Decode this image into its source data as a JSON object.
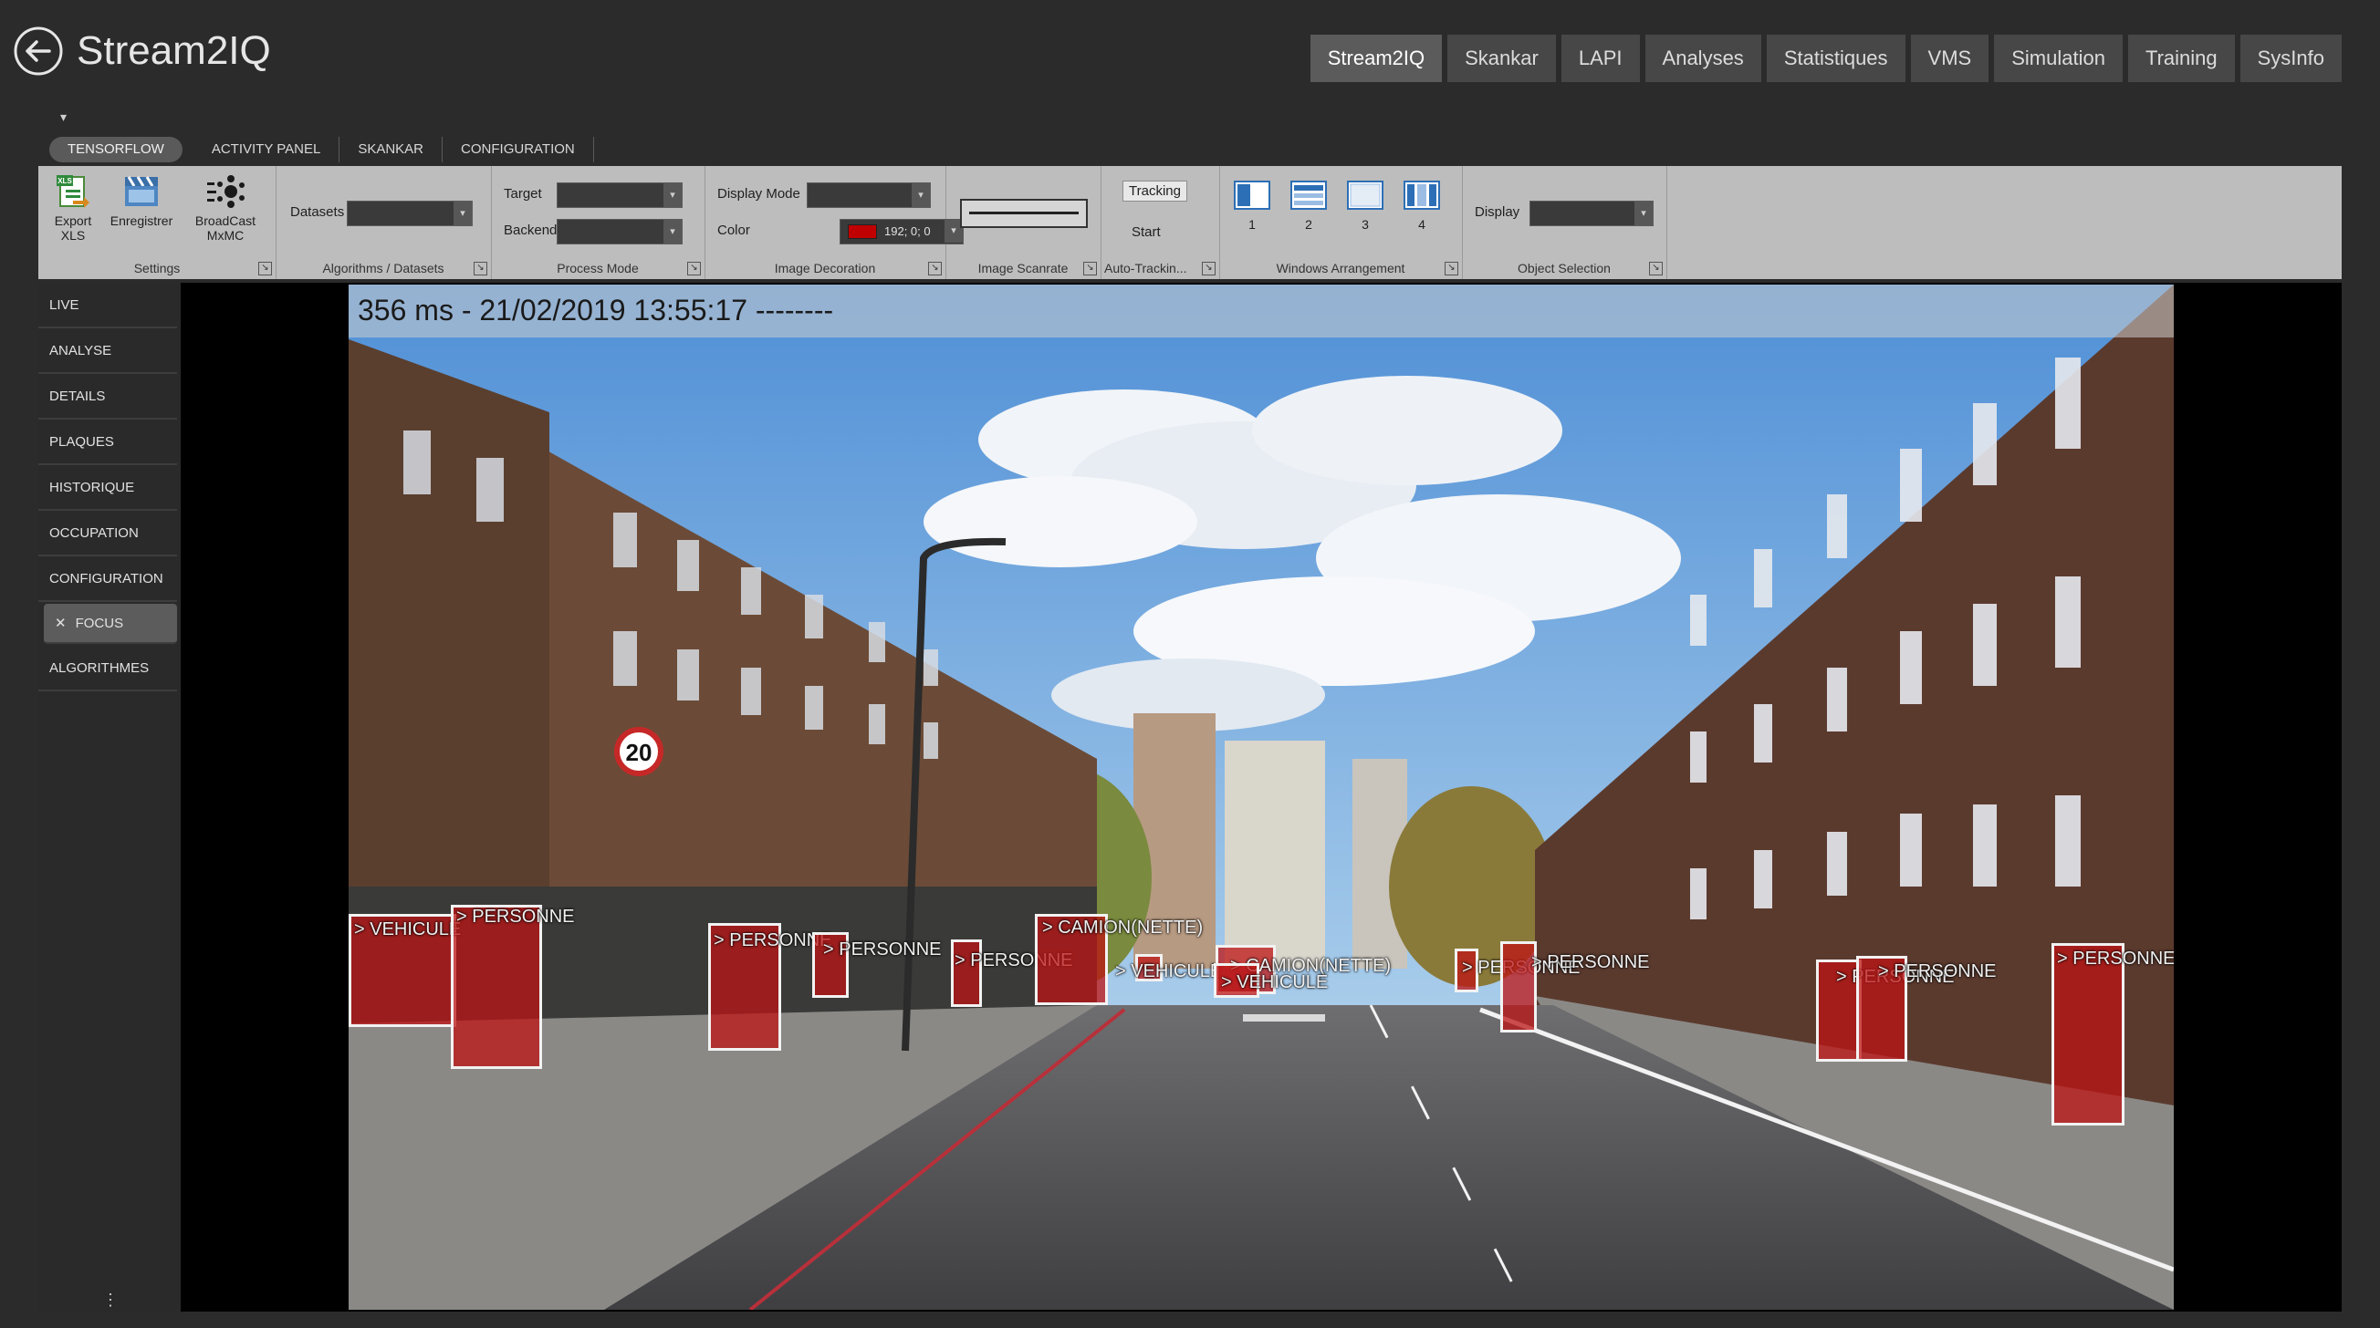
{
  "header": {
    "title": "Stream2IQ",
    "back_icon": "arrow-left-circle-icon",
    "nav": [
      {
        "label": "Stream2IQ",
        "active": true
      },
      {
        "label": "Skankar",
        "active": false
      },
      {
        "label": "LAPI",
        "active": false
      },
      {
        "label": "Analyses",
        "active": false
      },
      {
        "label": "Statistiques",
        "active": false
      },
      {
        "label": "VMS",
        "active": false
      },
      {
        "label": "Simulation",
        "active": false
      },
      {
        "label": "Training",
        "active": false
      },
      {
        "label": "SysInfo",
        "active": false
      }
    ]
  },
  "ribbon_tabs": [
    {
      "label": "TENSORFLOW",
      "active": true
    },
    {
      "label": "ACTIVITY PANEL",
      "active": false
    },
    {
      "label": "SKANKAR",
      "active": false
    },
    {
      "label": "CONFIGURATION",
      "active": false
    }
  ],
  "ribbon": {
    "settings": {
      "label": "Settings",
      "export_label_1": "Export",
      "export_label_2": "XLS",
      "record_label": "Enregistrer",
      "broadcast_label_1": "BroadCast",
      "broadcast_label_2": "MxMC"
    },
    "algorithms": {
      "label": "Algorithms / Datasets",
      "datasets_label": "Datasets",
      "datasets_value": ""
    },
    "process_mode": {
      "label": "Process Mode",
      "target_label": "Target",
      "target_value": "",
      "backend_label": "Backend",
      "backend_value": ""
    },
    "image_decoration": {
      "label": "Image Decoration",
      "display_mode_label": "Display Mode",
      "display_mode_value": "",
      "color_label": "Color",
      "color_value": "192; 0; 0",
      "color_hex": "#c00000"
    },
    "image_scanrate": {
      "label": "Image Scanrate"
    },
    "auto_tracking": {
      "label": "Auto-Trackin...",
      "tracking_label": "Tracking",
      "start_label": "Start"
    },
    "windows_arrangement": {
      "label": "Windows Arrangement",
      "options": [
        "1",
        "2",
        "3",
        "4"
      ]
    },
    "object_selection": {
      "label": "Object Selection",
      "display_label": "Display",
      "display_value": ""
    }
  },
  "sidebar": {
    "items": [
      {
        "label": "LIVE",
        "active": false
      },
      {
        "label": "ANALYSE",
        "active": false
      },
      {
        "label": "DETAILS",
        "active": false
      },
      {
        "label": "PLAQUES",
        "active": false
      },
      {
        "label": "HISTORIQUE",
        "active": false
      },
      {
        "label": "OCCUPATION",
        "active": false
      },
      {
        "label": "CONFIGURATION",
        "active": false
      },
      {
        "label": "FOCUS",
        "active": true
      },
      {
        "label": "ALGORITHMES",
        "active": false
      }
    ],
    "more": "..."
  },
  "video": {
    "overlay_text": "356 ms - 21/02/2019 13:55:17   --------",
    "detections": [
      {
        "label": "> VEHICULE"
      },
      {
        "label": "> PERSONNE"
      },
      {
        "label": "> PERSONNE"
      },
      {
        "label": "> PERSONNE"
      },
      {
        "label": "> PERSONNE"
      },
      {
        "label": "> CAMION(NETTE)"
      },
      {
        "label": "> VEHICULE"
      },
      {
        "label": "> CAMION(NETTE)"
      },
      {
        "label": "> VEHICULE"
      },
      {
        "label": "> PERSONNE"
      },
      {
        "label": "> PERSONNE"
      },
      {
        "label": "> PERSONNE"
      },
      {
        "label": "> PERSONNE"
      },
      {
        "label": "> PERSONNE"
      }
    ]
  }
}
